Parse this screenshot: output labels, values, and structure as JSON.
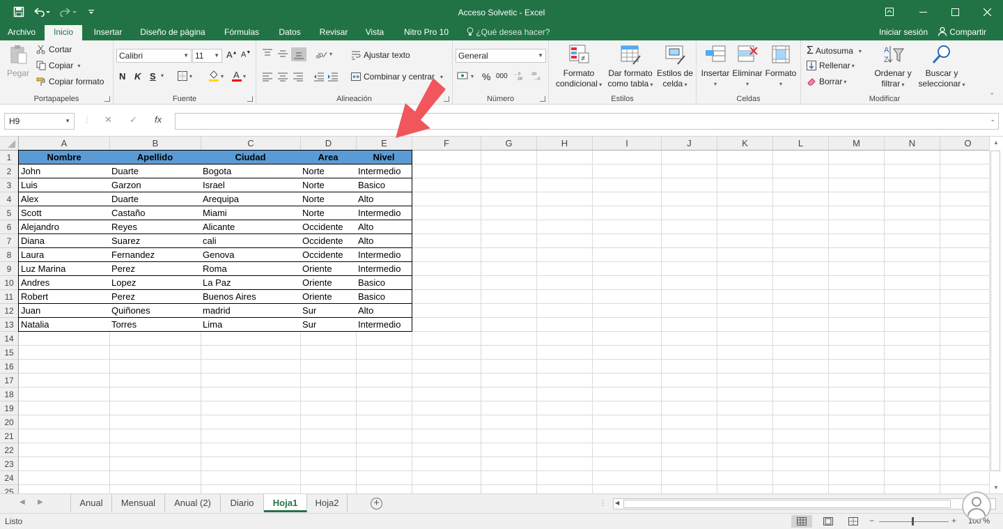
{
  "window": {
    "title": "Acceso Solvetic - Excel"
  },
  "qat": {
    "save_icon": "save-icon",
    "undo_icon": "undo-icon",
    "redo_icon": "redo-icon",
    "customize_icon": "customize-icon"
  },
  "tabs": [
    {
      "label": "Archivo"
    },
    {
      "label": "Inicio"
    },
    {
      "label": "Insertar"
    },
    {
      "label": "Diseño de página"
    },
    {
      "label": "Fórmulas"
    },
    {
      "label": "Datos"
    },
    {
      "label": "Revisar"
    },
    {
      "label": "Vista"
    },
    {
      "label": "Nitro Pro 10"
    }
  ],
  "active_tab": "Inicio",
  "tell_me": "¿Qué desea hacer?",
  "account": {
    "signin": "Iniciar sesión",
    "share": "Compartir"
  },
  "ribbon": {
    "clipboard": {
      "label": "Portapapeles",
      "paste": "Pegar",
      "cut": "Cortar",
      "copy": "Copiar",
      "format_painter": "Copiar formato"
    },
    "font": {
      "label": "Fuente",
      "name": "Calibri",
      "size": "11",
      "bold": "N",
      "italic": "K",
      "underline": "S"
    },
    "alignment": {
      "label": "Alineación",
      "wrap": "Ajustar texto",
      "merge": "Combinar y centrar"
    },
    "number": {
      "label": "Número",
      "format": "General",
      "percent": "%",
      "thousands": "000"
    },
    "styles": {
      "label": "Estilos",
      "conditional": [
        "Formato",
        "condicional"
      ],
      "as_table": [
        "Dar formato",
        "como tabla"
      ],
      "cell_styles": [
        "Estilos de",
        "celda"
      ]
    },
    "cells": {
      "label": "Celdas",
      "insert": "Insertar",
      "delete": "Eliminar",
      "format": "Formato"
    },
    "editing": {
      "label": "Modificar",
      "autosum": "Autosuma",
      "fill": "Rellenar",
      "clear": "Borrar",
      "sort": [
        "Ordenar y",
        "filtrar"
      ],
      "find": [
        "Buscar y",
        "seleccionar"
      ]
    }
  },
  "formula_bar": {
    "name_box": "H9",
    "fx": "fx",
    "value": ""
  },
  "columns": [
    "A",
    "B",
    "C",
    "D",
    "E",
    "F",
    "G",
    "H",
    "I",
    "J",
    "K",
    "L",
    "M",
    "N",
    "O"
  ],
  "rows": [
    "1",
    "2",
    "3",
    "4",
    "5",
    "6",
    "7",
    "8",
    "9",
    "10",
    "11",
    "12",
    "13",
    "14",
    "15",
    "16",
    "17",
    "18",
    "19",
    "20",
    "21",
    "22",
    "23",
    "24",
    "25"
  ],
  "table": {
    "headers": [
      "Nombre",
      "Apellido",
      "Ciudad",
      "Area",
      "Nivel"
    ],
    "rows": [
      [
        "John",
        "Duarte",
        "Bogota",
        "Norte",
        "Intermedio"
      ],
      [
        "Luis",
        "Garzon",
        "Israel",
        "Norte",
        "Basico"
      ],
      [
        "Alex",
        "Duarte",
        "Arequipa",
        "Norte",
        "Alto"
      ],
      [
        "Scott",
        "Castaño",
        "Miami",
        "Norte",
        "Intermedio"
      ],
      [
        "Alejandro",
        "Reyes",
        "Alicante",
        "Occidente",
        "Alto"
      ],
      [
        "Diana",
        "Suarez",
        "cali",
        "Occidente",
        "Alto"
      ],
      [
        "Laura",
        "Fernandez",
        "Genova",
        "Occidente",
        "Intermedio"
      ],
      [
        "Luz Marina",
        "Perez",
        "Roma",
        "Oriente",
        "Intermedio"
      ],
      [
        "Andres",
        "Lopez",
        "La Paz",
        "Oriente",
        "Basico"
      ],
      [
        "Robert",
        "Perez",
        "Buenos Aires",
        "Oriente",
        "Basico"
      ],
      [
        "Juan",
        "Quiñones",
        "madrid",
        "Sur",
        "Alto"
      ],
      [
        "Natalia",
        "Torres",
        "Lima",
        "Sur",
        "Intermedio"
      ]
    ]
  },
  "sheets": [
    "Anual",
    "Mensual",
    "Anual (2)",
    "Diario",
    "Hoja1",
    "Hoja2"
  ],
  "active_sheet": "Hoja1",
  "status": {
    "text": "Listo",
    "zoom": "100 %"
  },
  "colors": {
    "brand": "#217346",
    "header_fill": "#5b9bd5",
    "annotation_arrow": "#f0565c"
  }
}
